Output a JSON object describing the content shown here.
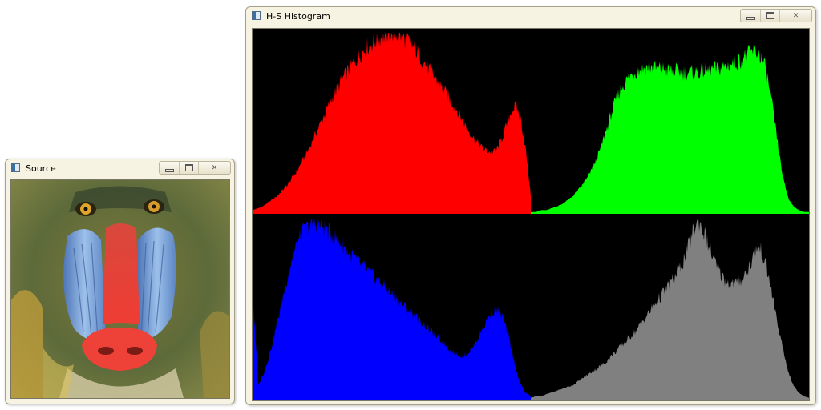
{
  "source_window": {
    "title": "Source",
    "image_name": "mandrill-baboon-face",
    "controls": {
      "minimize": "minimize-icon",
      "maximize": "maximize-icon",
      "close": "close-icon"
    }
  },
  "hist_window": {
    "title": "H-S Histogram",
    "controls": {
      "minimize": "minimize-icon",
      "maximize": "maximize-icon",
      "close": "close-icon"
    }
  },
  "panels": [
    {
      "name": "red-histogram",
      "color": "#ff0000",
      "profile": [
        2,
        3,
        4,
        6,
        8,
        10,
        13,
        16,
        20,
        24,
        29,
        34,
        40,
        46,
        52,
        58,
        63,
        69,
        74,
        78,
        82,
        86,
        89,
        92,
        94,
        96,
        98,
        99,
        100,
        99,
        98,
        96,
        93,
        90,
        86,
        82,
        78,
        74,
        70,
        66,
        62,
        58,
        53,
        48,
        44,
        40,
        37,
        35,
        34,
        35,
        40,
        48,
        56,
        60,
        52,
        35,
        10
      ]
    },
    {
      "name": "green-histogram",
      "color": "#00ff00",
      "profile": [
        1,
        1,
        2,
        2,
        3,
        4,
        5,
        7,
        9,
        12,
        15,
        19,
        24,
        30,
        38,
        47,
        56,
        64,
        70,
        74,
        77,
        79,
        80,
        81,
        81,
        80,
        80,
        79,
        79,
        79,
        78,
        78,
        78,
        78,
        79,
        79,
        80,
        80,
        81,
        82,
        83,
        84,
        86,
        88,
        90,
        89,
        84,
        72,
        55,
        35,
        18,
        8,
        4,
        2,
        1,
        1
      ]
    },
    {
      "name": "blue-histogram",
      "color": "#0000ff",
      "profile": [
        60,
        8,
        15,
        25,
        38,
        52,
        66,
        78,
        87,
        93,
        96,
        97,
        96,
        94,
        91,
        88,
        85,
        81,
        78,
        75,
        72,
        69,
        66,
        63,
        60,
        57,
        54,
        51,
        48,
        45,
        42,
        39,
        36,
        33,
        30,
        27,
        25,
        24,
        26,
        30,
        36,
        42,
        48,
        50,
        46,
        36,
        22,
        10,
        4,
        2
      ]
    },
    {
      "name": "gray-histogram",
      "color": "#808080",
      "profile": [
        1,
        2,
        2,
        3,
        4,
        5,
        6,
        7,
        8,
        10,
        12,
        14,
        16,
        18,
        20,
        23,
        26,
        29,
        32,
        35,
        38,
        42,
        46,
        50,
        54,
        58,
        62,
        66,
        70,
        76,
        84,
        94,
        99,
        92,
        84,
        76,
        70,
        66,
        64,
        64,
        66,
        70,
        76,
        84,
        82,
        72,
        58,
        42,
        28,
        16,
        8,
        4,
        2,
        1
      ]
    }
  ]
}
